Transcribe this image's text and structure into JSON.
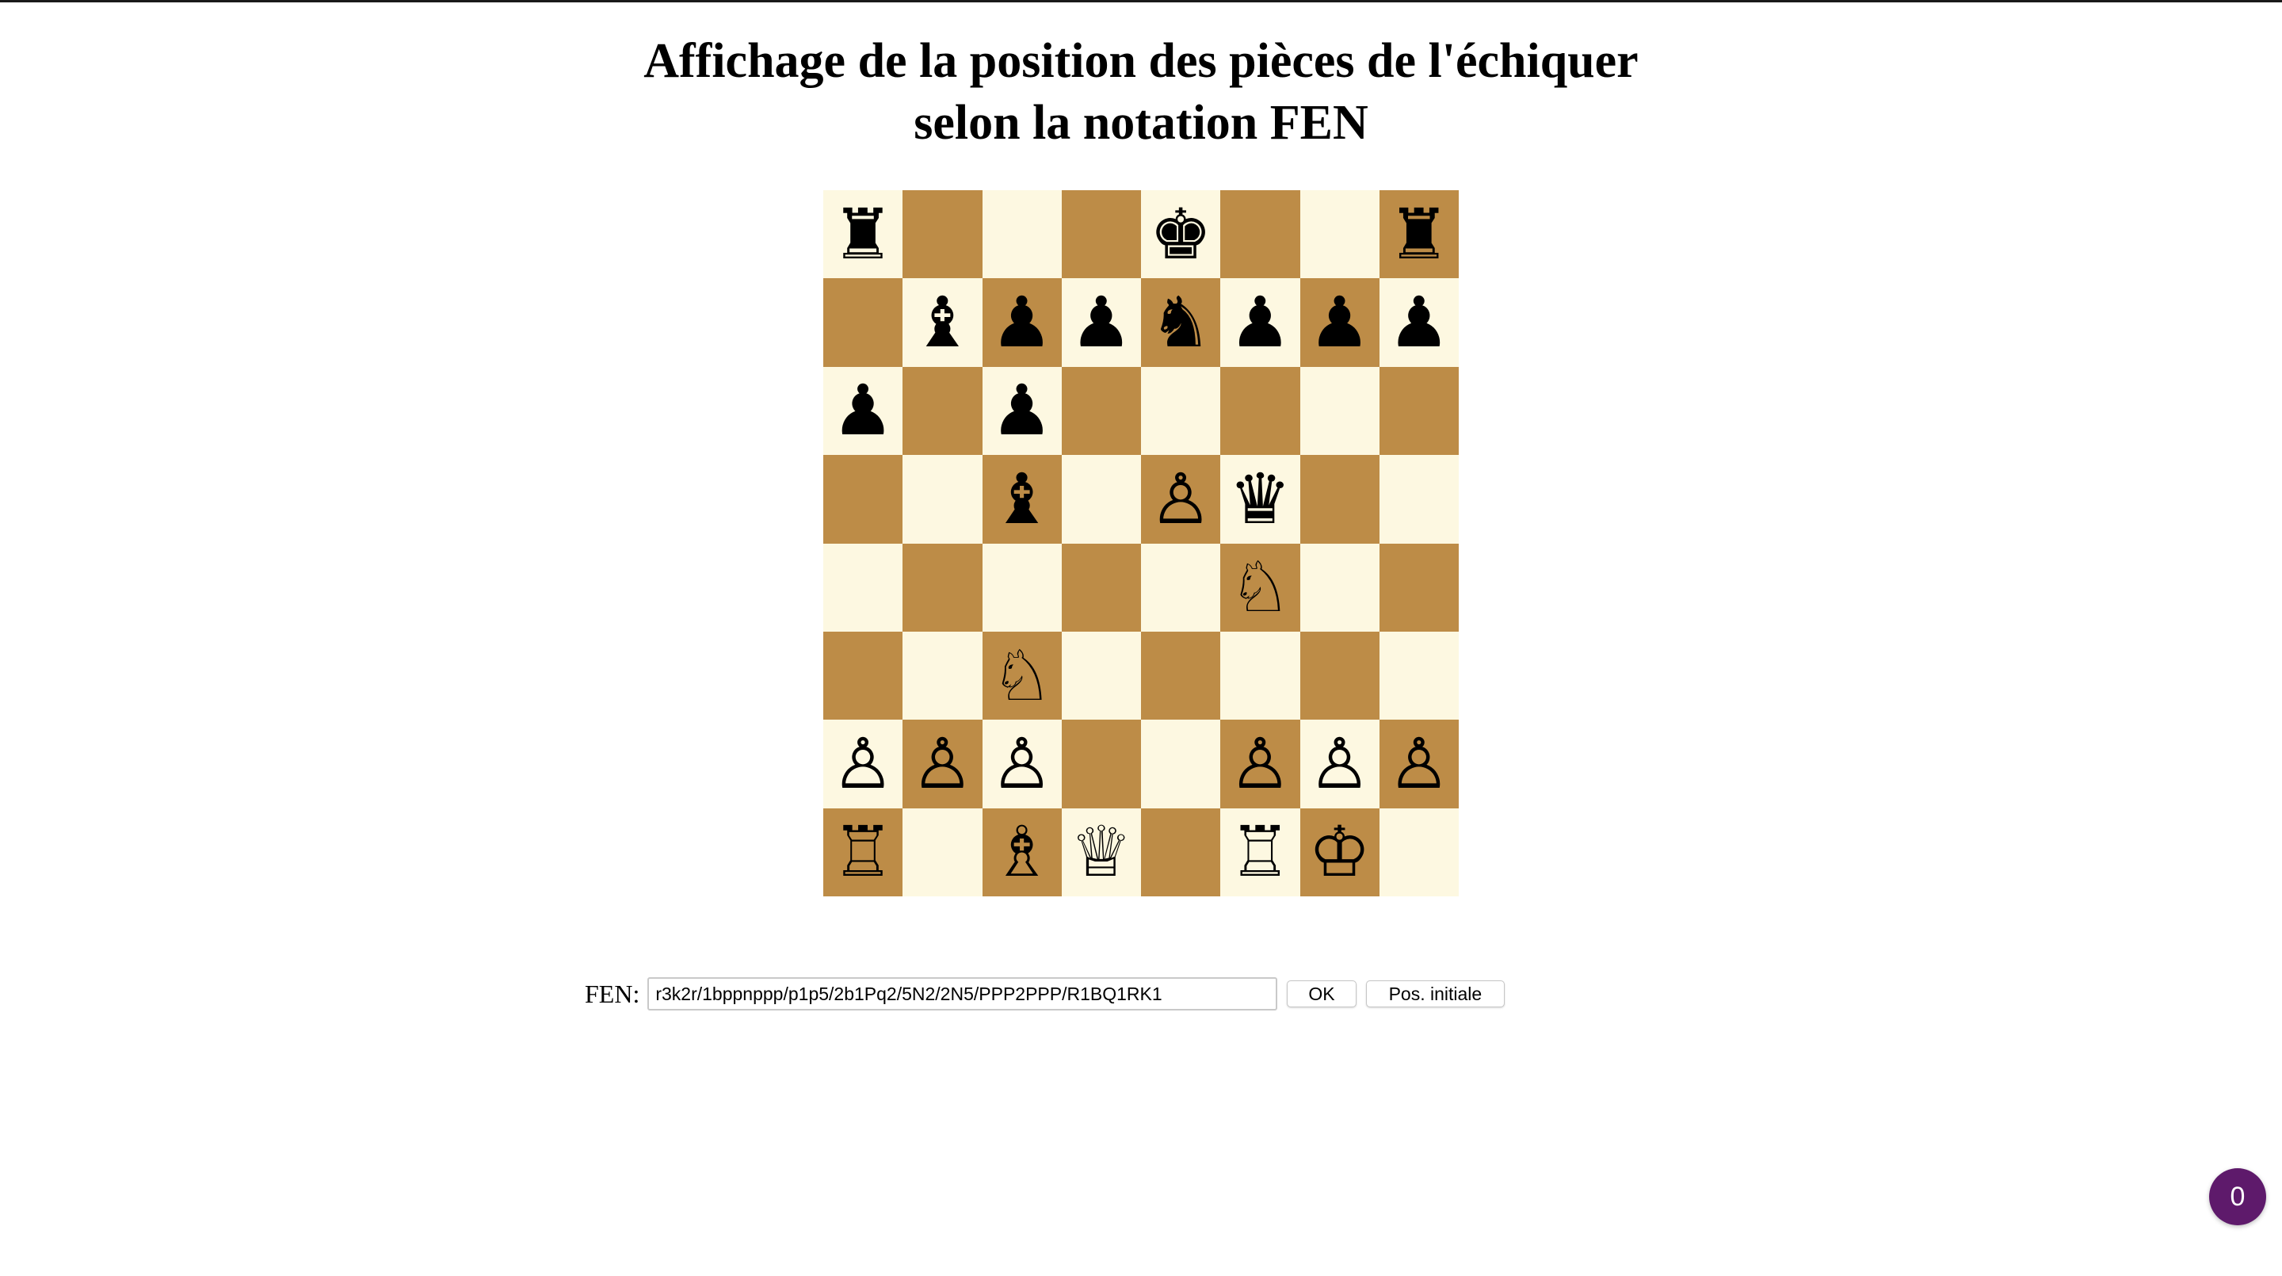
{
  "page": {
    "title_line1": "Affichage de la position des pièces de l'échiquer",
    "title_line2": "selon la notation FEN"
  },
  "board": {
    "colors": {
      "light": "#fdf8e1",
      "dark": "#bd8c47"
    },
    "ranks": [
      [
        "♜",
        "",
        "",
        "",
        "♚",
        "",
        "",
        "♜"
      ],
      [
        "",
        "♝",
        "♟",
        "♟",
        "♞",
        "♟",
        "♟",
        "♟"
      ],
      [
        "♟",
        "",
        "♟",
        "",
        "",
        "",
        "",
        ""
      ],
      [
        "",
        "",
        "♝",
        "",
        "♙",
        "♛",
        "",
        ""
      ],
      [
        "",
        "",
        "",
        "",
        "",
        "♘",
        "",
        ""
      ],
      [
        "",
        "",
        "♘",
        "",
        "",
        "",
        "",
        ""
      ],
      [
        "♙",
        "♙",
        "♙",
        "",
        "",
        "♙",
        "♙",
        "♙"
      ],
      [
        "♖",
        "",
        "♗",
        "♕",
        "",
        "♖",
        "♔",
        ""
      ]
    ]
  },
  "fen": {
    "label": "FEN:",
    "value": "r3k2r/1bppnppp/p1p5/2b1Pq2/5N2/2N5/PPP2PPP/R1BQ1RK1",
    "ok_label": "OK",
    "reset_label": "Pos. initiale"
  },
  "badge": {
    "count": "0",
    "color": "#5e1a6b"
  }
}
